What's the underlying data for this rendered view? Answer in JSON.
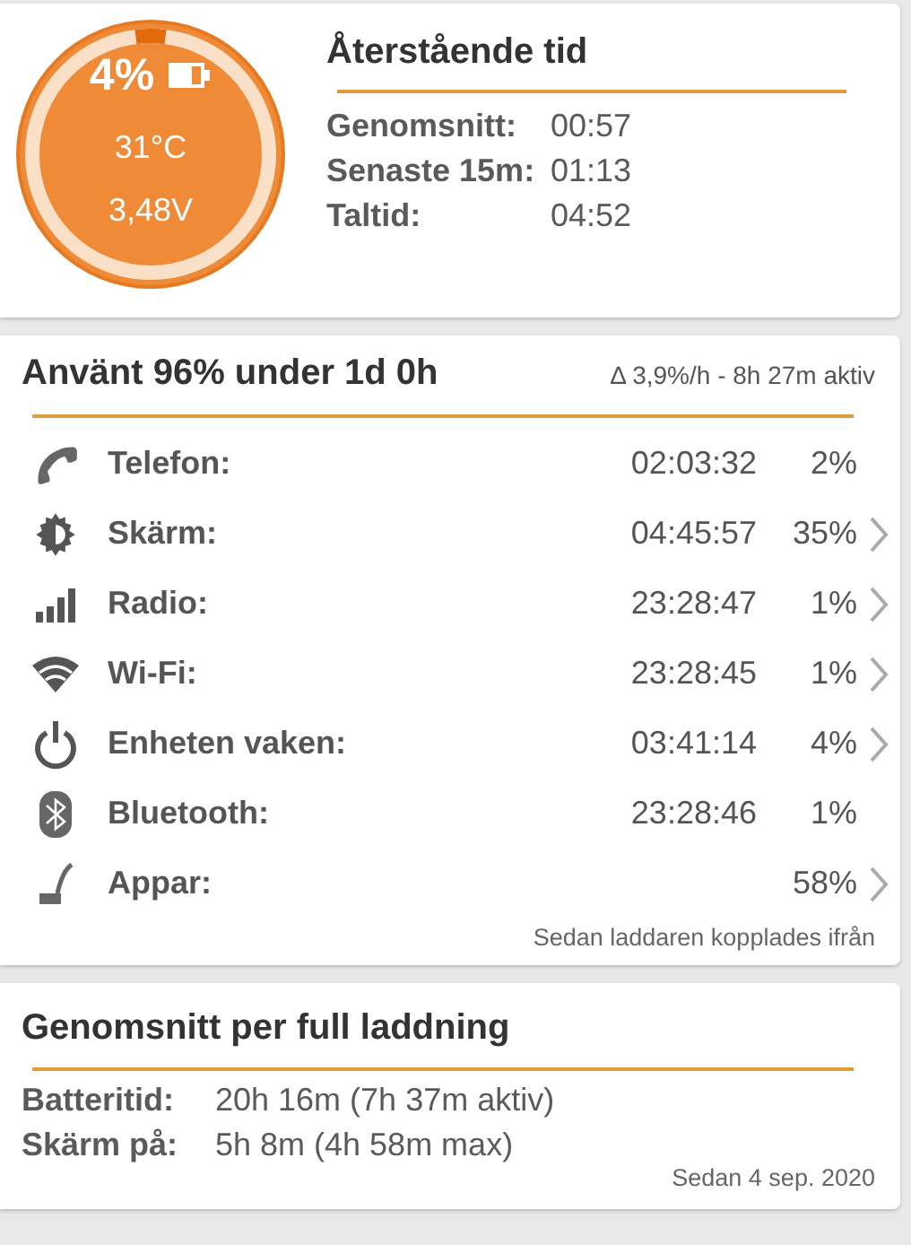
{
  "battery": {
    "percent": "4%",
    "level": 0.04,
    "temperature": "31°C",
    "voltage": "3,48V"
  },
  "remaining": {
    "title": "Återstående tid",
    "rows": [
      {
        "label": "Genomsnitt:",
        "value": "00:57"
      },
      {
        "label": "Senaste 15m:",
        "value": "01:13"
      },
      {
        "label": "Taltid:",
        "value": "04:52"
      }
    ]
  },
  "usage": {
    "title": "Använt 96% under 1d 0h",
    "rate": "Δ 3,9%/h - 8h 27m aktiv",
    "rows": [
      {
        "kind": "phone",
        "label": "Telefon:",
        "time": "02:03:32",
        "percent": "2%",
        "expandable": false
      },
      {
        "kind": "screen",
        "label": "Skärm:",
        "time": "04:45:57",
        "percent": "35%",
        "expandable": true
      },
      {
        "kind": "radio",
        "label": "Radio:",
        "time": "23:28:47",
        "percent": "1%",
        "expandable": true
      },
      {
        "kind": "wifi",
        "label": "Wi-Fi:",
        "time": "23:28:45",
        "percent": "1%",
        "expandable": true
      },
      {
        "kind": "power",
        "label": "Enheten vaken:",
        "time": "03:41:14",
        "percent": "4%",
        "expandable": true
      },
      {
        "kind": "bluetooth",
        "label": "Bluetooth:",
        "time": "23:28:46",
        "percent": "1%",
        "expandable": false
      },
      {
        "kind": "apps",
        "label": "Appar:",
        "percent": "58%",
        "expandable": true
      }
    ],
    "footer": "Sedan laddaren kopplades ifrån"
  },
  "full_charge": {
    "title": "Genomsnitt per full laddning",
    "rows": [
      {
        "label": "Batteritid:",
        "value": "20h 16m (7h 37m aktiv)"
      },
      {
        "label": "Skärm på:",
        "value": "5h 8m (4h 58m max)"
      }
    ],
    "footer": "Sedan 4 sep. 2020"
  }
}
